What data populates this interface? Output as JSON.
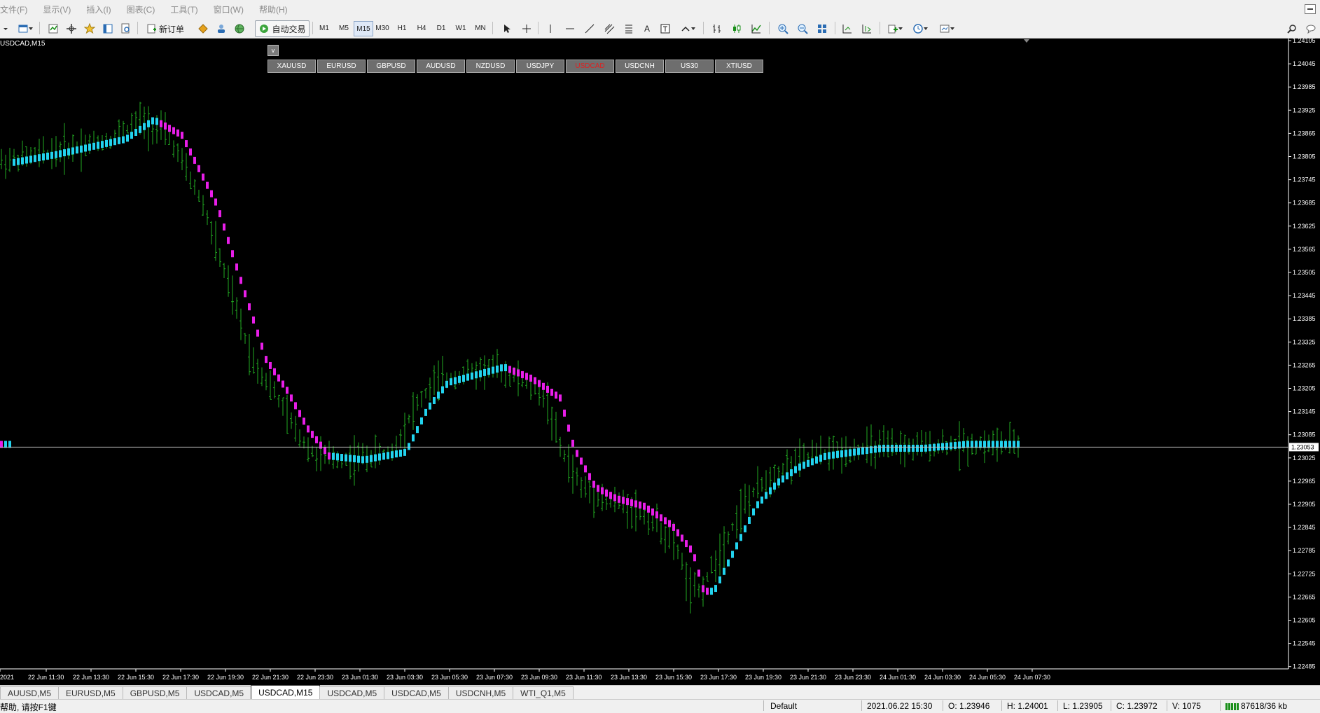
{
  "menu": [
    "文件(F)",
    "显示(V)",
    "插入(I)",
    "图表(C)",
    "工具(T)",
    "窗口(W)",
    "帮助(H)"
  ],
  "toolbar": {
    "new_order": "新订单",
    "auto_trading": "自动交易",
    "timeframes": [
      "M1",
      "M5",
      "M15",
      "M30",
      "H1",
      "H4",
      "D1",
      "W1",
      "MN"
    ],
    "active_timeframe": "M15"
  },
  "chart": {
    "title": "USDCAD,M15",
    "toggle_label": "v",
    "symbols": [
      "XAUUSD",
      "EURUSD",
      "GBPUSD",
      "AUDUSD",
      "NZDUSD",
      "USDJPY",
      "USDCAD",
      "USDCNH",
      "US30",
      "XTIUSD"
    ],
    "active_symbol": "USDCAD",
    "current_price": "1.23053",
    "price_labels": [
      "1.24105",
      "1.24045",
      "1.23985",
      "1.23925",
      "1.23865",
      "1.23805",
      "1.23745",
      "1.23685",
      "1.23625",
      "1.23565",
      "1.23505",
      "1.23445",
      "1.23385",
      "1.23325",
      "1.23265",
      "1.23205",
      "1.23145",
      "1.23085",
      "1.23025",
      "1.22965",
      "1.22905",
      "1.22845",
      "1.22785",
      "1.22725",
      "1.22665",
      "1.22605",
      "1.22545",
      "1.22485"
    ],
    "time_labels": [
      "2021",
      "22 Jun 11:30",
      "22 Jun 13:30",
      "22 Jun 15:30",
      "22 Jun 17:30",
      "22 Jun 19:30",
      "22 Jun 21:30",
      "22 Jun 23:30",
      "23 Jun 01:30",
      "23 Jun 03:30",
      "23 Jun 05:30",
      "23 Jun 07:30",
      "23 Jun 09:30",
      "23 Jun 11:30",
      "23 Jun 13:30",
      "23 Jun 15:30",
      "23 Jun 17:30",
      "23 Jun 19:30",
      "23 Jun 21:30",
      "23 Jun 23:30",
      "24 Jun 01:30",
      "24 Jun 03:30",
      "24 Jun 05:30",
      "24 Jun 07:30"
    ],
    "colors": {
      "background": "#000000",
      "bar": "#22aa22",
      "indicator_up": "#22d3ee",
      "indicator_down": "#e81ee8",
      "price_line": "#c0c0c0"
    }
  },
  "tabs": [
    "AUUSD,M5",
    "EURUSD,M5",
    "GBPUSD,M5",
    "USDCAD,M5",
    "USDCAD,M15",
    "USDCAD,M5",
    "USDCAD,M5",
    "USDCNH,M5",
    "WTI_Q1,M5"
  ],
  "active_tab": "USDCAD,M15",
  "status": {
    "help": "帮助, 请按F1键",
    "profile": "Default",
    "datetime": "2021.06.22 15:30",
    "open": "O: 1.23946",
    "high": "H: 1.24001",
    "low": "L: 1.23905",
    "close": "C: 1.23972",
    "volume": "V: 1075",
    "traffic": "87618/36 kb"
  }
}
